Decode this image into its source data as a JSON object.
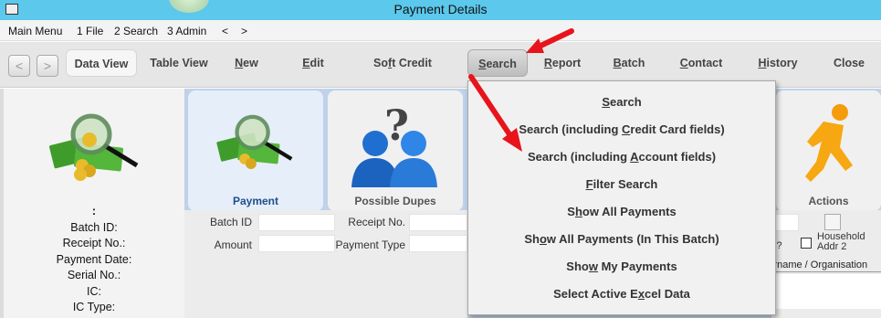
{
  "window": {
    "title": "Payment Details"
  },
  "menu": {
    "items": [
      "Main Menu",
      "1 File",
      "2 Search",
      "3 Admin",
      "<",
      ">"
    ]
  },
  "toolbar": {
    "back": "<",
    "forward": ">",
    "data_view": "Data View",
    "table_view": "Table View",
    "new": {
      "pre": "",
      "u": "N",
      "post": "ew"
    },
    "edit": {
      "pre": "",
      "u": "E",
      "post": "dit"
    },
    "soft_credit": {
      "pre": "So",
      "u": "f",
      "post": "t Credit"
    },
    "search": {
      "pre": "",
      "u": "S",
      "post": "earch"
    },
    "report": {
      "pre": "",
      "u": "R",
      "post": "eport"
    },
    "batch": {
      "pre": "",
      "u": "B",
      "post": "atch"
    },
    "contact": {
      "pre": "",
      "u": "C",
      "post": "ontact"
    },
    "history": {
      "pre": "",
      "u": "H",
      "post": "istory"
    },
    "close": "Close"
  },
  "summary": {
    "colon": ":",
    "labels": [
      "Batch ID:",
      "Receipt No.:",
      "Payment Date:",
      "Serial No.:",
      "IC:",
      "IC Type:"
    ]
  },
  "cards": {
    "payment": "Payment",
    "possible_dupes": "Possible Dupes",
    "actions": "Actions"
  },
  "form": {
    "batch_id_label": "Batch ID",
    "amount_label": "Amount",
    "receipt_no_label": "Receipt No.",
    "payment_type_label": "Payment Type",
    "batch_id_value": "",
    "amount_value": "",
    "receipt_no_value": "",
    "payment_type_value": ""
  },
  "right_panel": {
    "partial_question": "s?",
    "household_line1": "Household",
    "household_line2": "Addr 2",
    "surname_header": "irname / Organisation"
  },
  "dropdown": {
    "items": [
      {
        "pre": "",
        "u": "S",
        "post": "earch"
      },
      {
        "pre": "Search (including ",
        "u": "C",
        "post": "redit Card fields)"
      },
      {
        "pre": "Search (including ",
        "u": "A",
        "post": "ccount fields)"
      },
      {
        "pre": "",
        "u": "F",
        "post": "ilter Search"
      },
      {
        "pre": "S",
        "u": "h",
        "post": "ow All Payments"
      },
      {
        "pre": "Sh",
        "u": "o",
        "post": "w All Payments (In This Batch)"
      },
      {
        "pre": "Sho",
        "u": "w",
        "post": " My Payments"
      },
      {
        "pre": "Select Active E",
        "u": "x",
        "post": "cel Data"
      }
    ]
  },
  "colors": {
    "title_bar": "#5bc8ec",
    "card_active": "#e6eef9",
    "annotation_arrow": "#e8141b"
  }
}
